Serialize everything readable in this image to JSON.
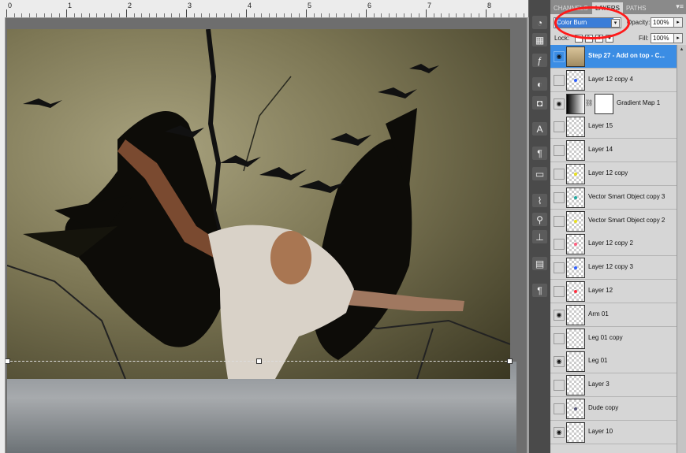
{
  "ruler": {
    "labels": [
      "0",
      "1",
      "2",
      "3",
      "4",
      "5",
      "6",
      "7",
      "8"
    ]
  },
  "panel": {
    "tabs": [
      {
        "label": "CHANNELS",
        "active": false
      },
      {
        "label": "LAYERS",
        "active": true
      },
      {
        "label": "PATHS",
        "active": false
      }
    ],
    "menu_icon": "panel-menu-icon",
    "blend_mode": "Color Burn",
    "opacity_label": "Opacity:",
    "opacity_value": "100%",
    "lock_label": "Lock:",
    "fill_label": "Fill:",
    "fill_value": "100%",
    "highlight_color": "#ff1a1a"
  },
  "layers": [
    {
      "name": "Step 27 - Add on top - C...",
      "visible": true,
      "selected": true
    },
    {
      "name": "Layer 12 copy 4",
      "visible": false,
      "selected": false,
      "dot_color": "#3060ff"
    },
    {
      "name": "Gradient Map 1",
      "visible": true,
      "selected": false,
      "type": "adjustment"
    },
    {
      "name": "Layer 15",
      "visible": false,
      "selected": false
    },
    {
      "name": "Layer 14",
      "visible": false,
      "selected": false
    },
    {
      "name": "Layer 12 copy",
      "visible": false,
      "selected": false,
      "dot_color": "#e8e020"
    },
    {
      "name": "Vector Smart Object copy 3",
      "visible": false,
      "selected": false,
      "dot_color": "#20a8a0"
    },
    {
      "name": "Vector Smart Object copy 2",
      "visible": false,
      "selected": false,
      "dot_color": "#e8e020"
    },
    {
      "name": "Layer 12 copy 2",
      "visible": false,
      "selected": false,
      "dot_color": "#ff6080"
    },
    {
      "name": "Layer 12 copy 3",
      "visible": false,
      "selected": false,
      "dot_color": "#3060ff"
    },
    {
      "name": "Layer 12",
      "visible": false,
      "selected": false,
      "dot_color": "#ff3040"
    },
    {
      "name": "Arm 01",
      "visible": true,
      "selected": false
    },
    {
      "name": "Leg 01 copy",
      "visible": false,
      "selected": false
    },
    {
      "name": "Leg 01",
      "visible": true,
      "selected": false
    },
    {
      "name": "Layer 3",
      "visible": false,
      "selected": false
    },
    {
      "name": "Dude copy",
      "visible": false,
      "selected": false,
      "dot_color": "#555577"
    },
    {
      "name": "Layer 10",
      "visible": true,
      "selected": false
    }
  ],
  "tools": [
    "color-wheel-icon",
    "swatch-grid-icon",
    "fx-icon",
    "adjust-circle-icon",
    "mask-icon",
    "type-icon",
    "paragraph-style-icon",
    "screen-icon",
    "brush-preset-icon",
    "clone-source-icon",
    "stamp-icon",
    "measure-icon",
    "paragraph-icon"
  ]
}
